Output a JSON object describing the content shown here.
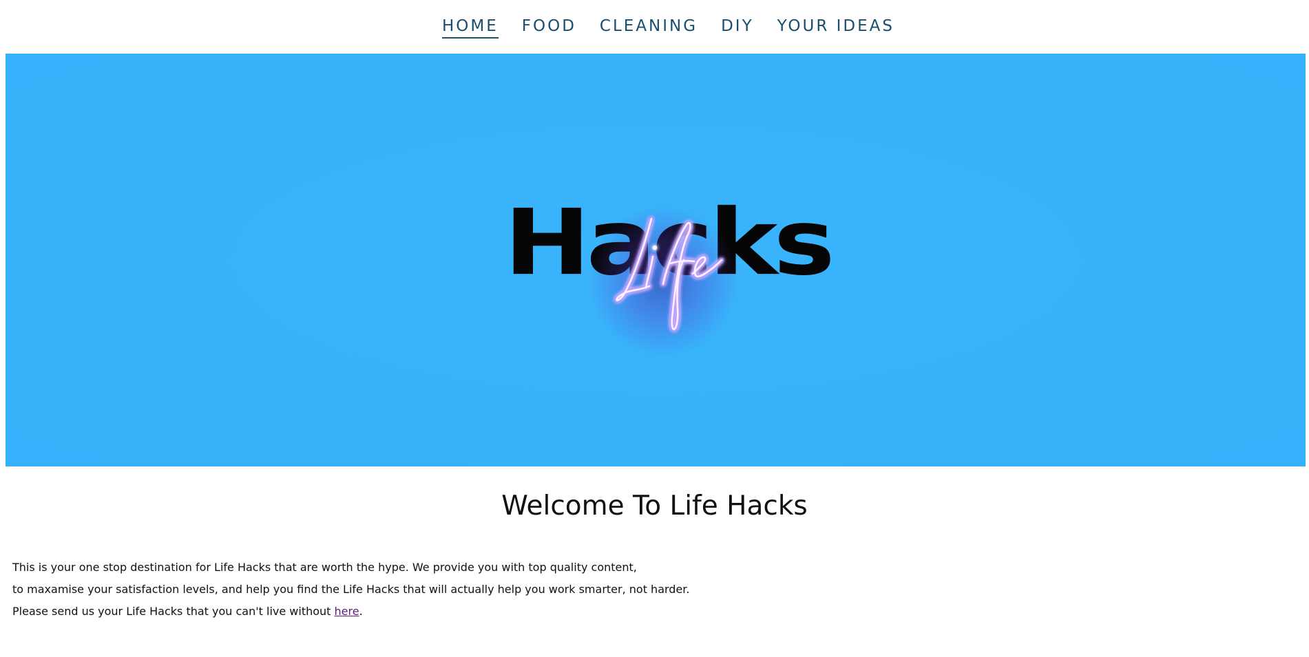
{
  "nav": {
    "items": [
      {
        "label": "HOME",
        "active": true
      },
      {
        "label": "FOOD",
        "active": false
      },
      {
        "label": "CLEANING",
        "active": false
      },
      {
        "label": "DIY",
        "active": false
      },
      {
        "label": "YOUR IDEAS",
        "active": false
      }
    ]
  },
  "hero": {
    "logo_main_text": "Hacks",
    "logo_script_text": "Life",
    "background_color": "#37b3fb",
    "neon_color": "#f4e6ff"
  },
  "welcome": {
    "title": "Welcome To Life Hacks"
  },
  "intro": {
    "line1": "This is your one stop destination for Life Hacks that are worth the hype. We provide you with top quality content,",
    "line2": "to maxamise your satisfaction levels, and help you find the Life Hacks that will actually help you work smarter, not harder.",
    "line3_prefix": "Please send us your Life Hacks that you can't live without ",
    "line3_link": "here",
    "line3_suffix": "."
  },
  "colors": {
    "nav_text": "#184e6e",
    "link": "#5a1e7c",
    "body_text": "#111111"
  }
}
